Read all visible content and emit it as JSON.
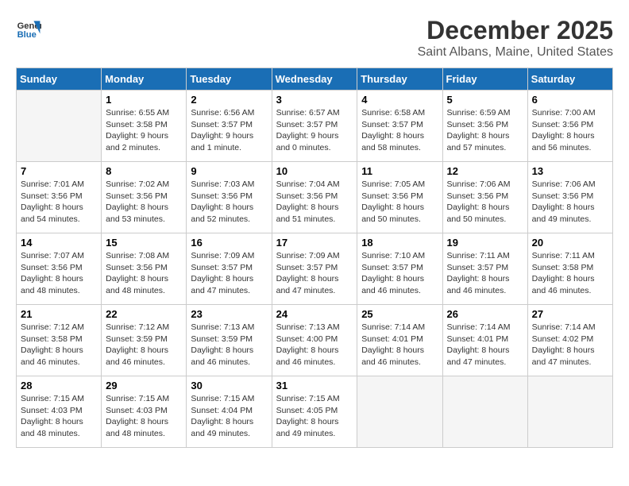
{
  "header": {
    "logo_line1": "General",
    "logo_line2": "Blue",
    "month": "December 2025",
    "location": "Saint Albans, Maine, United States"
  },
  "weekdays": [
    "Sunday",
    "Monday",
    "Tuesday",
    "Wednesday",
    "Thursday",
    "Friday",
    "Saturday"
  ],
  "weeks": [
    [
      {
        "day": "",
        "info": ""
      },
      {
        "day": "1",
        "info": "Sunrise: 6:55 AM\nSunset: 3:58 PM\nDaylight: 9 hours\nand 2 minutes."
      },
      {
        "day": "2",
        "info": "Sunrise: 6:56 AM\nSunset: 3:57 PM\nDaylight: 9 hours\nand 1 minute."
      },
      {
        "day": "3",
        "info": "Sunrise: 6:57 AM\nSunset: 3:57 PM\nDaylight: 9 hours\nand 0 minutes."
      },
      {
        "day": "4",
        "info": "Sunrise: 6:58 AM\nSunset: 3:57 PM\nDaylight: 8 hours\nand 58 minutes."
      },
      {
        "day": "5",
        "info": "Sunrise: 6:59 AM\nSunset: 3:56 PM\nDaylight: 8 hours\nand 57 minutes."
      },
      {
        "day": "6",
        "info": "Sunrise: 7:00 AM\nSunset: 3:56 PM\nDaylight: 8 hours\nand 56 minutes."
      }
    ],
    [
      {
        "day": "7",
        "info": "Sunrise: 7:01 AM\nSunset: 3:56 PM\nDaylight: 8 hours\nand 54 minutes."
      },
      {
        "day": "8",
        "info": "Sunrise: 7:02 AM\nSunset: 3:56 PM\nDaylight: 8 hours\nand 53 minutes."
      },
      {
        "day": "9",
        "info": "Sunrise: 7:03 AM\nSunset: 3:56 PM\nDaylight: 8 hours\nand 52 minutes."
      },
      {
        "day": "10",
        "info": "Sunrise: 7:04 AM\nSunset: 3:56 PM\nDaylight: 8 hours\nand 51 minutes."
      },
      {
        "day": "11",
        "info": "Sunrise: 7:05 AM\nSunset: 3:56 PM\nDaylight: 8 hours\nand 50 minutes."
      },
      {
        "day": "12",
        "info": "Sunrise: 7:06 AM\nSunset: 3:56 PM\nDaylight: 8 hours\nand 50 minutes."
      },
      {
        "day": "13",
        "info": "Sunrise: 7:06 AM\nSunset: 3:56 PM\nDaylight: 8 hours\nand 49 minutes."
      }
    ],
    [
      {
        "day": "14",
        "info": "Sunrise: 7:07 AM\nSunset: 3:56 PM\nDaylight: 8 hours\nand 48 minutes."
      },
      {
        "day": "15",
        "info": "Sunrise: 7:08 AM\nSunset: 3:56 PM\nDaylight: 8 hours\nand 48 minutes."
      },
      {
        "day": "16",
        "info": "Sunrise: 7:09 AM\nSunset: 3:57 PM\nDaylight: 8 hours\nand 47 minutes."
      },
      {
        "day": "17",
        "info": "Sunrise: 7:09 AM\nSunset: 3:57 PM\nDaylight: 8 hours\nand 47 minutes."
      },
      {
        "day": "18",
        "info": "Sunrise: 7:10 AM\nSunset: 3:57 PM\nDaylight: 8 hours\nand 46 minutes."
      },
      {
        "day": "19",
        "info": "Sunrise: 7:11 AM\nSunset: 3:57 PM\nDaylight: 8 hours\nand 46 minutes."
      },
      {
        "day": "20",
        "info": "Sunrise: 7:11 AM\nSunset: 3:58 PM\nDaylight: 8 hours\nand 46 minutes."
      }
    ],
    [
      {
        "day": "21",
        "info": "Sunrise: 7:12 AM\nSunset: 3:58 PM\nDaylight: 8 hours\nand 46 minutes."
      },
      {
        "day": "22",
        "info": "Sunrise: 7:12 AM\nSunset: 3:59 PM\nDaylight: 8 hours\nand 46 minutes."
      },
      {
        "day": "23",
        "info": "Sunrise: 7:13 AM\nSunset: 3:59 PM\nDaylight: 8 hours\nand 46 minutes."
      },
      {
        "day": "24",
        "info": "Sunrise: 7:13 AM\nSunset: 4:00 PM\nDaylight: 8 hours\nand 46 minutes."
      },
      {
        "day": "25",
        "info": "Sunrise: 7:14 AM\nSunset: 4:01 PM\nDaylight: 8 hours\nand 46 minutes."
      },
      {
        "day": "26",
        "info": "Sunrise: 7:14 AM\nSunset: 4:01 PM\nDaylight: 8 hours\nand 47 minutes."
      },
      {
        "day": "27",
        "info": "Sunrise: 7:14 AM\nSunset: 4:02 PM\nDaylight: 8 hours\nand 47 minutes."
      }
    ],
    [
      {
        "day": "28",
        "info": "Sunrise: 7:15 AM\nSunset: 4:03 PM\nDaylight: 8 hours\nand 48 minutes."
      },
      {
        "day": "29",
        "info": "Sunrise: 7:15 AM\nSunset: 4:03 PM\nDaylight: 8 hours\nand 48 minutes."
      },
      {
        "day": "30",
        "info": "Sunrise: 7:15 AM\nSunset: 4:04 PM\nDaylight: 8 hours\nand 49 minutes."
      },
      {
        "day": "31",
        "info": "Sunrise: 7:15 AM\nSunset: 4:05 PM\nDaylight: 8 hours\nand 49 minutes."
      },
      {
        "day": "",
        "info": ""
      },
      {
        "day": "",
        "info": ""
      },
      {
        "day": "",
        "info": ""
      }
    ]
  ]
}
